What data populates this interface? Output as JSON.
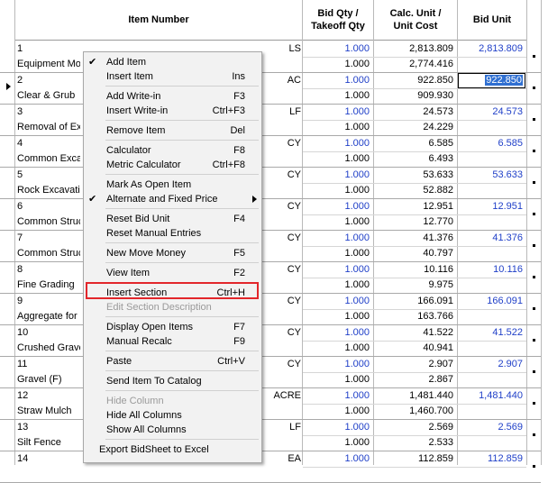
{
  "columns": {
    "item": "Item Number",
    "bid_qty": "Bid Qty /",
    "takeoff_qty": "Takeoff Qty",
    "calc_unit": "Calc. Unit /",
    "unit_cost": "Unit Cost",
    "bid_unit": "Bid Unit"
  },
  "rows": [
    {
      "num": "1",
      "desc": "Equipment Mob",
      "uom": "LS",
      "qty1": "1.000",
      "qty2": "1.000",
      "calc": "2,813.809",
      "cost": "2,774.416",
      "bid": "2,813.809"
    },
    {
      "num": "2",
      "desc": "Clear & Grub",
      "uom": "AC",
      "qty1": "1.000",
      "qty2": "1.000",
      "calc": "922.850",
      "cost": "909.930",
      "bid": "922.850"
    },
    {
      "num": "3",
      "desc": "Removal of Exi",
      "uom": "LF",
      "qty1": "1.000",
      "qty2": "1.000",
      "calc": "24.573",
      "cost": "24.229",
      "bid": "24.573"
    },
    {
      "num": "4",
      "desc": "Common Excav",
      "uom": "CY",
      "qty1": "1.000",
      "qty2": "1.000",
      "calc": "6.585",
      "cost": "6.493",
      "bid": "6.585"
    },
    {
      "num": "5",
      "desc": "Rock Excavatio",
      "uom": "CY",
      "qty1": "1.000",
      "qty2": "1.000",
      "calc": "53.633",
      "cost": "52.882",
      "bid": "53.633"
    },
    {
      "num": "6",
      "desc": "Common Struc",
      "uom": "CY",
      "qty1": "1.000",
      "qty2": "1.000",
      "calc": "12.951",
      "cost": "12.770",
      "bid": "12.951"
    },
    {
      "num": "7",
      "desc": "Common Struc",
      "uom": "CY",
      "qty1": "1.000",
      "qty2": "1.000",
      "calc": "41.376",
      "cost": "40.797",
      "bid": "41.376"
    },
    {
      "num": "8",
      "desc": "Fine Grading",
      "uom": "CY",
      "qty1": "1.000",
      "qty2": "1.000",
      "calc": "10.116",
      "cost": "9.975",
      "bid": "10.116"
    },
    {
      "num": "9",
      "desc": "Aggregate for S",
      "uom": "CY",
      "qty1": "1.000",
      "qty2": "1.000",
      "calc": "166.091",
      "cost": "163.766",
      "bid": "166.091"
    },
    {
      "num": "10",
      "desc": "Crushed Grave",
      "uom": "CY",
      "qty1": "1.000",
      "qty2": "1.000",
      "calc": "41.522",
      "cost": "40.941",
      "bid": "41.522"
    },
    {
      "num": "11",
      "desc": "Gravel (F)",
      "uom": "CY",
      "qty1": "1.000",
      "qty2": "1.000",
      "calc": "2.907",
      "cost": "2.867",
      "bid": "2.907"
    },
    {
      "num": "12",
      "desc": "Straw Mulch",
      "uom": "ACRE",
      "qty1": "1.000",
      "qty2": "1.000",
      "calc": "1,481.440",
      "cost": "1,460.700",
      "bid": "1,481.440"
    },
    {
      "num": "13",
      "desc": "Silt Fence",
      "uom": "LF",
      "qty1": "1.000",
      "qty2": "1.000",
      "calc": "2.569",
      "cost": "2.533",
      "bid": "2.569"
    },
    {
      "num": "14",
      "desc": "",
      "uom": "EA",
      "qty1": "1.000",
      "qty2": "",
      "calc": "112.859",
      "cost": "",
      "bid": "112.859"
    }
  ],
  "menu": [
    {
      "label": "Add Item",
      "shortcut": "",
      "checked": true
    },
    {
      "label": "Insert Item",
      "shortcut": "Ins"
    },
    {
      "sep": true
    },
    {
      "label": "Add Write-in",
      "shortcut": "F3"
    },
    {
      "label": "Insert Write-in",
      "shortcut": "Ctrl+F3"
    },
    {
      "sep": true
    },
    {
      "label": "Remove Item",
      "shortcut": "Del"
    },
    {
      "sep": true
    },
    {
      "label": "Calculator",
      "shortcut": "F8"
    },
    {
      "label": "Metric Calculator",
      "shortcut": "Ctrl+F8"
    },
    {
      "sep": true
    },
    {
      "label": "Mark As Open Item",
      "shortcut": ""
    },
    {
      "label": "Alternate and Fixed Price",
      "shortcut": "",
      "checked": true,
      "submenu": true
    },
    {
      "sep": true
    },
    {
      "label": "Reset Bid Unit",
      "shortcut": "F4"
    },
    {
      "label": "Reset Manual Entries",
      "shortcut": ""
    },
    {
      "sep": true
    },
    {
      "label": "New Move Money",
      "shortcut": "F5"
    },
    {
      "sep": true
    },
    {
      "label": "View Item",
      "shortcut": "F2"
    },
    {
      "sep": true
    },
    {
      "label": "Insert Section",
      "shortcut": "Ctrl+H",
      "highlight": true
    },
    {
      "label": "Edit Section Description",
      "shortcut": "",
      "disabled": true
    },
    {
      "sep": true
    },
    {
      "label": "Display Open Items",
      "shortcut": "F7"
    },
    {
      "label": "Manual Recalc",
      "shortcut": "F9"
    },
    {
      "sep": true
    },
    {
      "label": "Paste",
      "shortcut": "Ctrl+V"
    },
    {
      "sep": true
    },
    {
      "label": "Send Item To Catalog",
      "shortcut": ""
    },
    {
      "sep": true
    },
    {
      "label": "Hide Column",
      "shortcut": "",
      "disabled": true
    },
    {
      "label": "Hide All Columns",
      "shortcut": ""
    },
    {
      "label": "Show All Columns",
      "shortcut": ""
    },
    {
      "sep": true
    },
    {
      "label": "Export BidSheet to Excel",
      "shortcut": "",
      "indent": true
    }
  ],
  "colors": {
    "blue_value": "#1f3fc8",
    "selection": "#2f6fd1",
    "highlight_box": "#e2262b"
  }
}
